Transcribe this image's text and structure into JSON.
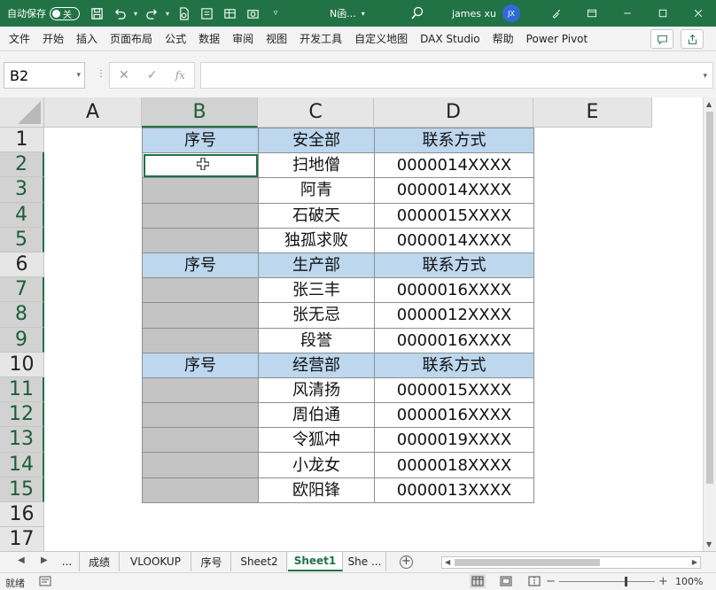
{
  "titlebar": {
    "autosave_label": "自动保存",
    "autosave_state": "关",
    "filename": "N函...",
    "user": "james xu",
    "avatar_initials": "JX"
  },
  "ribbon": {
    "tabs": [
      "文件",
      "开始",
      "插入",
      "页面布局",
      "公式",
      "数据",
      "审阅",
      "视图",
      "开发工具",
      "自定义地图",
      "DAX Studio",
      "帮助",
      "Power Pivot"
    ]
  },
  "formula_bar": {
    "name_box": "B2",
    "fx_label": "fx",
    "formula": ""
  },
  "columns": [
    "A",
    "B",
    "C",
    "D",
    "E"
  ],
  "rows": [
    "1",
    "2",
    "3",
    "4",
    "5",
    "6",
    "7",
    "8",
    "9",
    "10",
    "11",
    "12",
    "13",
    "14",
    "15",
    "16",
    "17"
  ],
  "table": [
    {
      "type": "hdr",
      "b": "序号",
      "c": "安全部",
      "d": "联系方式"
    },
    {
      "type": "data",
      "b": "",
      "c": "扫地僧",
      "d": "0000014XXXX",
      "active": true
    },
    {
      "type": "data",
      "b": "",
      "c": "阿青",
      "d": "0000014XXXX"
    },
    {
      "type": "data",
      "b": "",
      "c": "石破天",
      "d": "0000015XXXX"
    },
    {
      "type": "data",
      "b": "",
      "c": "独孤求败",
      "d": "0000014XXXX"
    },
    {
      "type": "hdr",
      "b": "序号",
      "c": "生产部",
      "d": "联系方式"
    },
    {
      "type": "data",
      "b": "",
      "c": "张三丰",
      "d": "0000016XXXX"
    },
    {
      "type": "data",
      "b": "",
      "c": "张无忌",
      "d": "0000012XXXX"
    },
    {
      "type": "data",
      "b": "",
      "c": "段誉",
      "d": "0000016XXXX"
    },
    {
      "type": "hdr",
      "b": "序号",
      "c": "经营部",
      "d": "联系方式"
    },
    {
      "type": "data",
      "b": "",
      "c": "风清扬",
      "d": "0000015XXXX"
    },
    {
      "type": "data",
      "b": "",
      "c": "周伯通",
      "d": "0000016XXXX"
    },
    {
      "type": "data",
      "b": "",
      "c": "令狐冲",
      "d": "0000019XXXX"
    },
    {
      "type": "data",
      "b": "",
      "c": "小龙女",
      "d": "0000018XXXX"
    },
    {
      "type": "data",
      "b": "",
      "c": "欧阳锋",
      "d": "0000013XXXX"
    }
  ],
  "sheet_tabs": [
    {
      "label": "...",
      "active": false
    },
    {
      "label": "成绩",
      "active": false
    },
    {
      "label": "VLOOKUP",
      "active": false
    },
    {
      "label": "序号",
      "active": false
    },
    {
      "label": "Sheet2",
      "active": false
    },
    {
      "label": "Sheet1",
      "active": true
    },
    {
      "label": "She ...",
      "active": false
    }
  ],
  "status": {
    "ready": "就绪",
    "zoom": "100%"
  },
  "colors": {
    "excel_green": "#217346",
    "header_blue": "#bdd7ee",
    "gray_cell": "#c4c4c4"
  }
}
